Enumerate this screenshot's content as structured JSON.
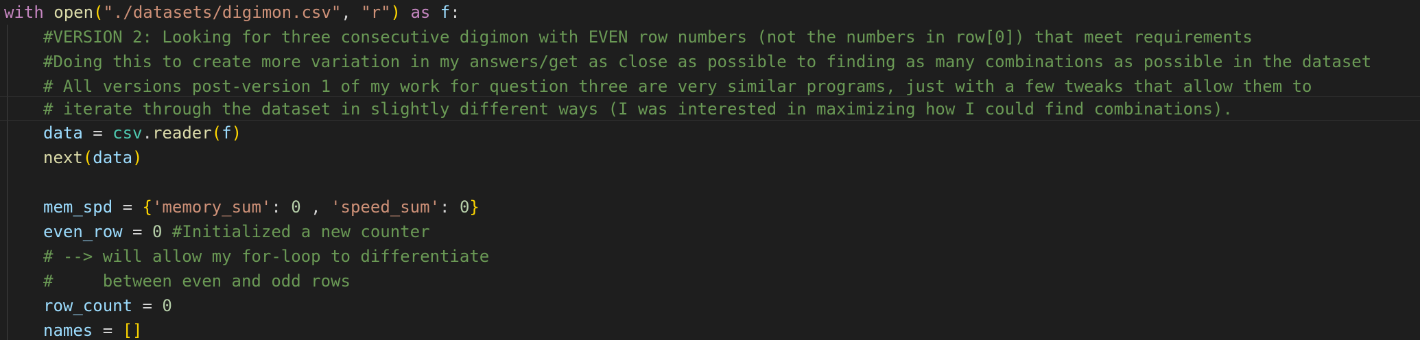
{
  "editor": {
    "line1": {
      "kw_with": "with",
      "fn_open": "open",
      "p_open": "(",
      "str_path": "\"./datasets/digimon.csv\"",
      "comma": ", ",
      "str_mode": "\"r\"",
      "p_close": ")",
      "kw_as": " as ",
      "var_f": "f",
      "colon": ":"
    },
    "line2": {
      "comment": "#VERSION 2: Looking for three consecutive digimon with EVEN row numbers (not the numbers in row[0]) that meet requirements"
    },
    "line3": {
      "comment": "#Doing this to create more variation in my answers/get as close as possible to finding as many combinations as possible in the dataset"
    },
    "line4": {
      "comment": "# All versions post-version 1 of my work for question three are very similar programs, just with a few tweaks that allow them to"
    },
    "line5": {
      "comment": "# iterate through the dataset in slightly different ways (I was interested in maximizing how I could find combinations)."
    },
    "line6": {
      "var_data": "data",
      "eq": " = ",
      "mod_csv": "csv",
      "dot": ".",
      "fn_reader": "reader",
      "p_open": "(",
      "var_f": "f",
      "p_close": ")"
    },
    "line7": {
      "fn_next": "next",
      "p_open": "(",
      "var_data": "data",
      "p_close": ")"
    },
    "line9": {
      "var_mem_spd": "mem_spd",
      "eq": " = ",
      "b_open": "{",
      "str_key1": "'memory_sum'",
      "colon1": ": ",
      "num1": "0",
      "sep": " , ",
      "str_key2": "'speed_sum'",
      "colon2": ": ",
      "num2": "0",
      "b_close": "}"
    },
    "line10": {
      "var_even_row": "even_row",
      "eq": " = ",
      "num": "0",
      "comment": " #Initialized a new counter"
    },
    "line11": {
      "comment": "# --> will allow my for-loop to differentiate"
    },
    "line12": {
      "comment": "#     between even and odd rows"
    },
    "line13": {
      "var_row_count": "row_count",
      "eq": " = ",
      "num": "0"
    },
    "line14": {
      "var_names": "names",
      "eq": " = ",
      "brackets": "[]"
    },
    "colors": {
      "background": "#1e1e1e",
      "keyword": "#c586c0",
      "function": "#dcdcaa",
      "string": "#ce9178",
      "variable": "#9cdcfe",
      "module": "#4ec9b0",
      "number": "#b5cea8",
      "comment": "#6a9955",
      "bracket_level1": "#ffd700",
      "bracket_level2": "#da70d6"
    }
  }
}
